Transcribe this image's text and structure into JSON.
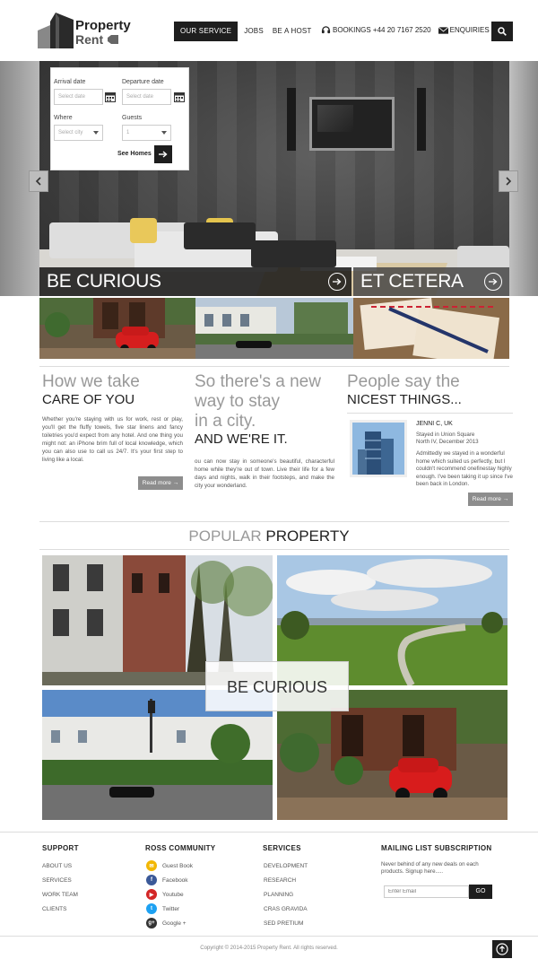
{
  "header": {
    "logo_line1": "Property",
    "logo_line2": "Rent",
    "nav": [
      "OUR SERVICE",
      "JOBS",
      "BE A HOST"
    ],
    "bookings_label": "BOOKINGS +44 20 7167 2520",
    "enquiries_label": "ENQUIRIES",
    "search_icon": "search-icon"
  },
  "booking": {
    "arrival_label": "Arrival date",
    "arrival_placeholder": "Select date",
    "departure_label": "Departure date",
    "departure_placeholder": "Select date",
    "where_label": "Where",
    "where_value": "Select city",
    "guests_label": "Guests",
    "guests_value": "1",
    "see_homes": "See Homes"
  },
  "hero": {
    "bar_left": "BE CURIOUS",
    "bar_right": "ET CETERA"
  },
  "columns": {
    "care": {
      "title1": "How we take",
      "title2": "CARE OF YOU",
      "body": "Whether you're staying with us for work, rest or play, you'll get the fluffy towels, five star linens and fancy toiletries you'd expect from any hotel. And one thing you might not: an iPhone brim full of local knowledge, which you can also use to call us 24/7. It's your first step to living like a local.",
      "read_more": "Read more →"
    },
    "newway": {
      "title1": "So there's a new",
      "title2": "way to stay",
      "title3": "in a city.",
      "title4": "AND WE'RE IT.",
      "body": "ou can now stay in someone's beautiful, characterful home while they're out of town. Live their life for a few days and nights, walk in their footsteps, and make the city your wonderland."
    },
    "people": {
      "title1": "People say the",
      "title2": "NICEST THINGS...",
      "name": "JENNI C, UK",
      "sub1": "Stayed in Union Square",
      "sub2": "North IV, December 2013",
      "quote": "Admittedly we stayed in a wonderful home which suited us perfectly, but I couldn't recommend onefinestay highly enough. I've been taking it up since I've been back in London.",
      "read_more": "Read more →"
    }
  },
  "popular": {
    "title_light": "POPULAR",
    "title_bold": "PROPERTY",
    "overlay": "BE CURIOUS"
  },
  "footer": {
    "support_head": "SUPPORT",
    "support_links": [
      "ABOUT US",
      "SERVICES",
      "WORK TEAM",
      "CLIENTS"
    ],
    "community_head": "ROSS COMMUNITY",
    "community_links": [
      {
        "label": "Guest Book",
        "icon": "guestbook-icon",
        "color": "#f2b705"
      },
      {
        "label": "Facebook",
        "icon": "facebook-icon",
        "color": "#3b5998"
      },
      {
        "label": "Youtube",
        "icon": "youtube-icon",
        "color": "#d32626"
      },
      {
        "label": "Twitter",
        "icon": "twitter-icon",
        "color": "#1da1f2"
      },
      {
        "label": "Google +",
        "icon": "googleplus-icon",
        "color": "#333333"
      }
    ],
    "services_head": "SERVICES",
    "services_links": [
      "DEVELOPMENT",
      "RESEARCH",
      "PLANNING",
      "CRAS GRAVIDA",
      "SED PRETIUM"
    ],
    "mail_head": "MAILING LIST SUBSCRIPTION",
    "mail_text": "Never behind of any new deals on each products. Signup here.....",
    "email_placeholder": "Enter Email",
    "go_label": "GO",
    "copyright": "Copyright © 2014-2015 Property Rent. All rights reserved."
  }
}
